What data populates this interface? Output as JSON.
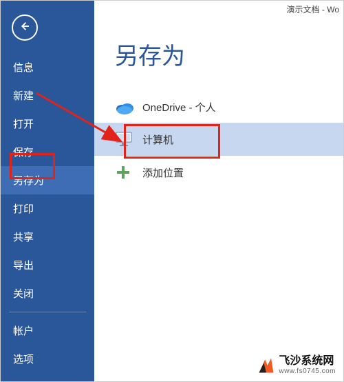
{
  "titlebar": "演示文档 - Wo",
  "page_title": "另存为",
  "sidebar": {
    "items": [
      {
        "label": "信息"
      },
      {
        "label": "新建"
      },
      {
        "label": "打开"
      },
      {
        "label": "保存"
      },
      {
        "label": "另存为",
        "selected": true
      },
      {
        "label": "打印"
      },
      {
        "label": "共享"
      },
      {
        "label": "导出"
      },
      {
        "label": "关闭"
      }
    ],
    "footer_items": [
      {
        "label": "帐户"
      },
      {
        "label": "选项"
      }
    ]
  },
  "locations": {
    "items": [
      {
        "label": "OneDrive - 个人",
        "icon": "onedrive"
      },
      {
        "label": "计算机",
        "icon": "computer",
        "selected": true
      },
      {
        "label": "添加位置",
        "icon": "add"
      }
    ]
  },
  "watermark": {
    "title": "飞沙系统网",
    "url": "www.fs0745.com"
  }
}
